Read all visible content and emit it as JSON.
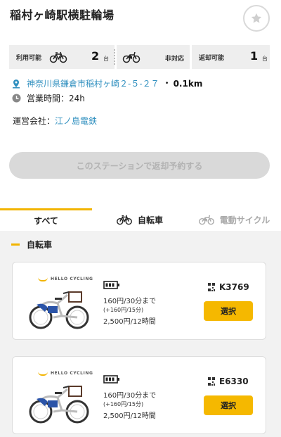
{
  "station": {
    "name": "稲村ヶ崎駅横駐輪場",
    "favorite_icon": "star-icon"
  },
  "stats": {
    "rent_label": "利用可能",
    "rent_count": "2",
    "rent_unit": "台",
    "ebike_status": "非対応",
    "return_label": "返却可能",
    "return_count": "1",
    "return_unit": "台"
  },
  "info": {
    "address": "神奈川県鎌倉市稲村ヶ崎２-５-２７",
    "distance_sep": "•",
    "distance": "0.1km",
    "hours": "営業時間：24h",
    "operator_label": "運営会社：",
    "operator_name": "江ノ島電鉄"
  },
  "reserve_button": "このステーションで返却予約する",
  "tabs": [
    {
      "label": "すべて",
      "active": true
    },
    {
      "label": "自転車",
      "active": false
    },
    {
      "label": "電動サイクル",
      "active": false
    }
  ],
  "section_title": "自転車",
  "cards": [
    {
      "brand": "HELLO CYCLING",
      "price_line1": "160円/30分まで",
      "price_line2": "(+160円/15分)",
      "price_line3": "2,500円/12時間",
      "code": "K3769",
      "select_label": "選択"
    },
    {
      "brand": "HELLO CYCLING",
      "price_line1": "160円/30分まで",
      "price_line2": "(+160円/15分)",
      "price_line3": "2,500円/12時間",
      "code": "E6330",
      "select_label": "選択"
    }
  ],
  "colors": {
    "accent": "#f2b400",
    "link": "#2f8fbf",
    "disabled_button": "#d9d9d9"
  }
}
